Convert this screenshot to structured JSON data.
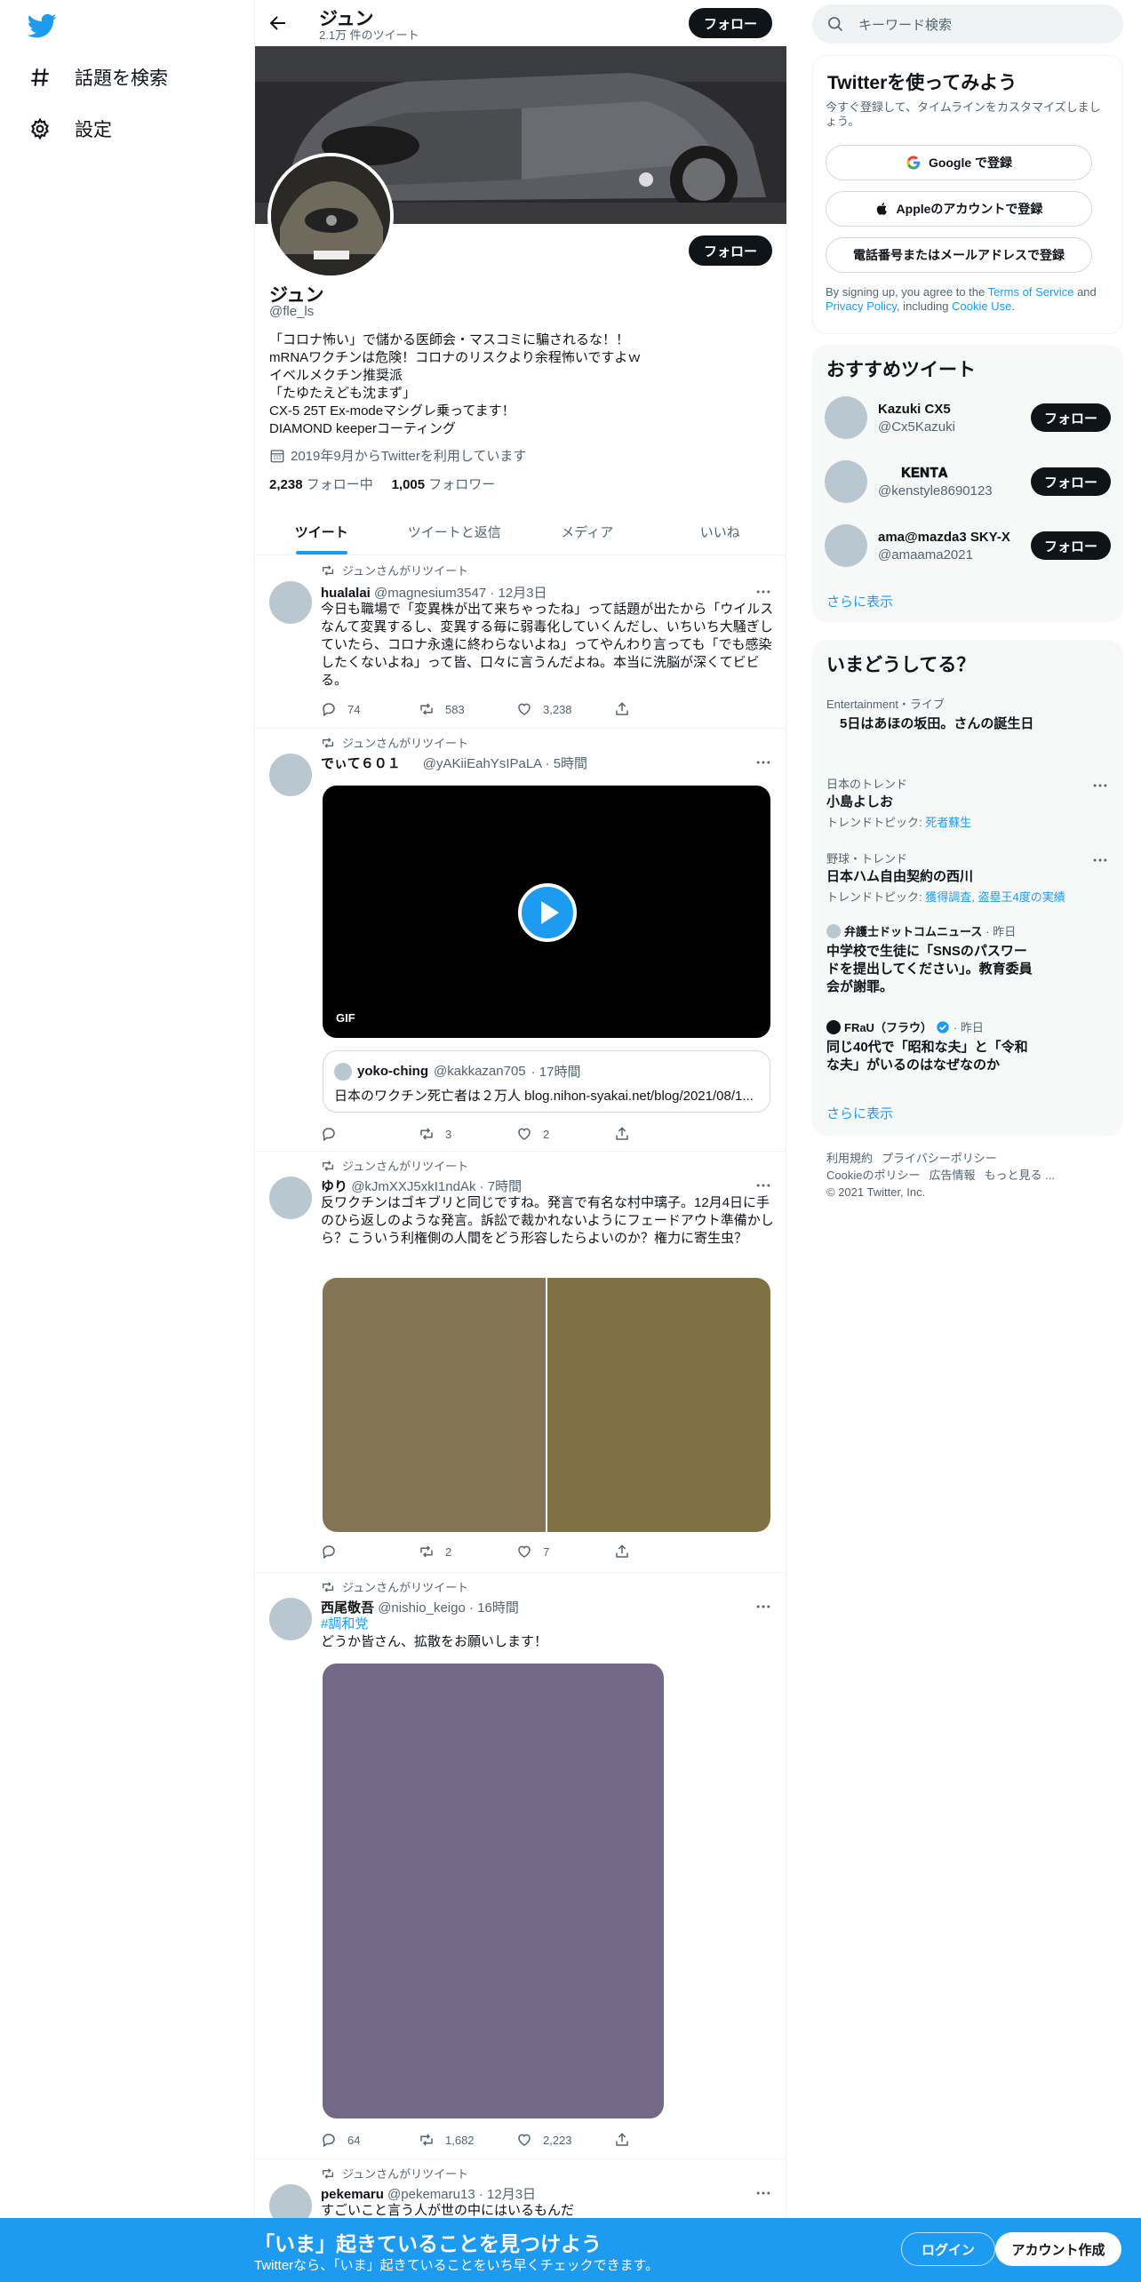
{
  "colors": {
    "accent": "#1d9bf0",
    "text": "#0f1419",
    "muted": "#536471"
  },
  "nav": {
    "logo_icon": "twitter-bird-icon",
    "items": [
      {
        "label": "話題を検索",
        "icon": "hashtag-icon"
      },
      {
        "label": "設定",
        "icon": "gear-icon"
      }
    ]
  },
  "header": {
    "name": "ジュン",
    "tweet_count": "2.1万 件のツイート",
    "follow_label": "フォロー"
  },
  "profile": {
    "name": "ジュン",
    "handle": "@fle_ls",
    "follow_label": "フォロー",
    "bio": "「コロナ怖い」で儲かる医師会・マスコミに騙されるな！！\nmRNAワクチンは危険！コロナのリスクより余程怖いですよｗ\nイベルメクチン推奨派\n「たゆたえども沈まず」\nCX-5 25T Ex-modeマシグレ乗ってます！\nDIAMOND keeperコーティング",
    "joined": "2019年9月からTwitterを利用しています",
    "following_count": "2,238",
    "following_label": "フォロー中",
    "followers_count": "1,005",
    "followers_label": "フォロワー"
  },
  "tabs": [
    {
      "label": "ツイート"
    },
    {
      "label": "ツイートと返信"
    },
    {
      "label": "メディア"
    },
    {
      "label": "いいね"
    }
  ],
  "tweets": [
    {
      "retweet_label": "ジュンさんがリツイート",
      "name": "hualalai",
      "handle": "@magnesium3547",
      "time": "· 12月3日",
      "text": "今日も職場で「変異株が出て来ちゃったね」って話題が出たから「ウイルスなんて変異するし、変異する毎に弱毒化していくんだし、いちいち大騒ぎしていたら、コロナ永遠に終わらないよね」ってやんわり言っても「でも感染したくないよね」って皆、口々に言うんだよね。本当に洗脳が深くてビビる。",
      "replies": "74",
      "retweets": "583",
      "likes": "3,238"
    },
    {
      "retweet_label": "ジュンさんがリツイート",
      "name": "でぃて６０１",
      "handle": "@yAKiiEahYsIPaLA",
      "time": "· 5時間",
      "gif_label": "GIF",
      "quote_name": "yoko-ching",
      "quote_handle": "@kakkazan705",
      "quote_time": "· 17時間",
      "quote_text": "日本のワクチン死亡者は２万人 blog.nihon-syakai.net/blog/2021/08/1...",
      "replies": "",
      "retweets": "3",
      "likes": "2"
    },
    {
      "retweet_label": "ジュンさんがリツイート",
      "name": "ゆり",
      "handle": "@kJmXXJ5xkI1ndAk",
      "time": "· 7時間",
      "text": "反ワクチンはゴキブリと同じですね。発言で有名な村中璃子。12月4日に手のひら返しのような発言。訴訟で裁かれないようにフェードアウト準備かしら？こういう利権側の人間をどう形容したらよいのか？権力に寄生虫？",
      "replies": "",
      "retweets": "2",
      "likes": "7"
    },
    {
      "retweet_label": "ジュンさんがリツイート",
      "name": "西尾敬吾",
      "handle": "@nishio_keigo",
      "time": "· 16時間",
      "hashtag": "#調和党",
      "text": "どうか皆さん、拡散をお願いします！",
      "replies": "64",
      "retweets": "1,682",
      "likes": "2,223"
    },
    {
      "retweet_label": "ジュンさんがリツイート",
      "name": "pekemaru",
      "handle": "@pekemaru13",
      "time": "· 12月3日",
      "text": "すごいこと言う人が世の中にはいるもんだ"
    }
  ],
  "search": {
    "placeholder": "キーワード検索"
  },
  "signup": {
    "title": "Twitterを使ってみよう",
    "subtitle": "今すぐ登録して、タイムラインをカスタマイズしましょう。",
    "google": "Google で登録",
    "apple": "Appleのアカウントで登録",
    "phone": "電話番号またはメールアドレスで登録",
    "terms_prefix": "By signing up, you agree to the",
    "terms": "Terms of Service",
    "and": "and",
    "privacy": "Privacy Policy",
    ", including": ", including",
    "cookie": "Cookie Use",
    "period": "."
  },
  "recommend": {
    "title": "おすすめツイート",
    "follow_label": "フォロー",
    "show_more": "さらに表示",
    "users": [
      {
        "name": "Kazuki CX5",
        "handle": "@Cx5Kazuki"
      },
      {
        "name": "𝐊𝐄𝐍𝐓𝐀",
        "handle": "@kenstyle8690123"
      },
      {
        "name": "ama@mazda3 SKY-X",
        "handle": "@amaama2021"
      }
    ]
  },
  "trends": {
    "title": "いまどうしてる？",
    "show_more": "さらに表示",
    "items": [
      {
        "category": "Entertainment・ライブ",
        "name": "　5日はあほの坂田。さんの誕生日"
      },
      {
        "category": "日本のトレンド",
        "name": "小島よしお",
        "sub_prefix": "トレンドトピック: ",
        "sub": "死者蘇生"
      },
      {
        "category": "野球・トレンド",
        "name": "日本ハム自由契約の西川",
        "sub_prefix": "トレンドトピック: ",
        "sub": "獲得調査, 盗塁王4度の実績"
      },
      {
        "source": "弁護士ドットコムニュース",
        "time": "· 昨日",
        "name": "中学校で生徒に「SNSのパスワードを提出してください」。教育委員会が謝罪。"
      },
      {
        "source": "FRaU（フラウ）",
        "time": "· 昨日",
        "name": "同じ40代で「昭和な夫」と「令和な夫」がいるのはなぜなのか"
      }
    ]
  },
  "footer": {
    "terms": "利用規約",
    "privacy": "プライバシーポリシー",
    "cookie": "Cookieのポリシー",
    "ads": "広告情報",
    "more": "もっと見る ...",
    "copyright": "© 2021 Twitter, Inc."
  },
  "bottom": {
    "title": "「いま」起きていることを見つけよう",
    "subtitle": "Twitterなら、「いま」起きていることをいち早くチェックできます。",
    "login": "ログイン",
    "signup": "アカウント作成"
  }
}
